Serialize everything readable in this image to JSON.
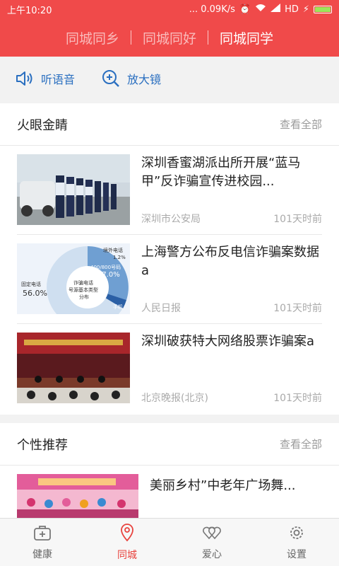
{
  "status_bar": {
    "time": "上午10:20",
    "speed": "... 0.09K/s",
    "network": "HD"
  },
  "top_tabs": [
    {
      "label": "同城同乡",
      "active": false
    },
    {
      "label": "同城同好",
      "active": false
    },
    {
      "label": "同城同学",
      "active": true
    }
  ],
  "toolbar": {
    "listen_label": "听语音",
    "zoom_label": "放大镜"
  },
  "section1": {
    "title": "火眼金睛",
    "more": "查看全部",
    "items": [
      {
        "headline": "深圳香蜜湖派出所开展“蓝马甲”反诈骗宣传进校园...",
        "source": "深圳市公安局",
        "time": "101天时前"
      },
      {
        "headline": "上海警方公布反电信诈骗案数据a",
        "source": "人民日报",
        "time": "101天时前"
      },
      {
        "headline": "深圳破获特大网络股票诈骗案a",
        "source": "北京晚报(北京)",
        "time": "101天时前"
      }
    ]
  },
  "pie_labels": {
    "outside": "境外电话",
    "outside_pct": "1.2%",
    "hotline": "400/800号码",
    "hotline_pct": "27.0%",
    "fixed": "固定电话",
    "fixed_pct": "56.0%",
    "center1": "诈骗电话",
    "center2": "号源基本类型",
    "center3": "分布",
    "mobile": "手机"
  },
  "section2": {
    "title": "个性推荐",
    "more": "查看全部",
    "items": [
      {
        "headline": "美丽乡村”中老年广场舞..."
      }
    ]
  },
  "nav": [
    {
      "label": "健康",
      "icon": "health-kit-icon",
      "active": false
    },
    {
      "label": "同城",
      "icon": "location-pin-icon",
      "active": true
    },
    {
      "label": "爱心",
      "icon": "hearts-icon",
      "active": false
    },
    {
      "label": "设置",
      "icon": "gear-icon",
      "active": false
    }
  ],
  "colors": {
    "brand_red": "#f04a4a",
    "link_blue": "#2a6fc0",
    "nav_active": "#e8433e"
  }
}
